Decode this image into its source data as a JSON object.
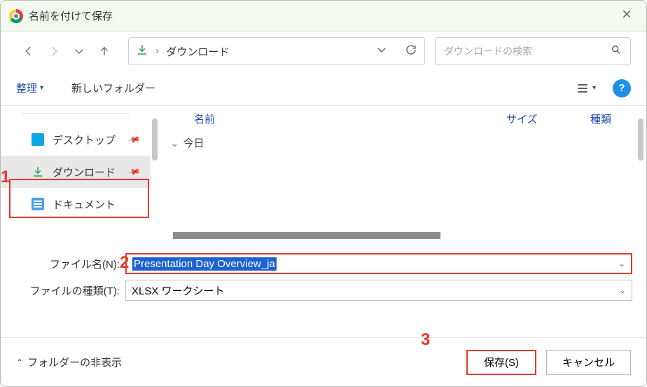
{
  "title": "名前を付けて保存",
  "breadcrumb": {
    "folder": "ダウンロード"
  },
  "search": {
    "placeholder": "ダウンロードの検索"
  },
  "toolbar": {
    "organize": "整理",
    "new_folder": "新しいフォルダー"
  },
  "sidebar": {
    "items": [
      {
        "label": "デスクトップ"
      },
      {
        "label": "ダウンロード"
      },
      {
        "label": "ドキュメント"
      }
    ]
  },
  "columns": {
    "name": "名前",
    "size": "サイズ",
    "type": "種類"
  },
  "group_today": "今日",
  "filename_label": "ファイル名(N):",
  "filename_value": "Presentation Day Overview_ja",
  "filetype_label": "ファイルの種類(T):",
  "filetype_value": "XLSX ワークシート",
  "footer": {
    "hide_folders": "フォルダーの非表示",
    "save": "保存(S)",
    "cancel": "キャンセル"
  },
  "annotations": {
    "one": "1",
    "two": "2",
    "three": "3"
  }
}
